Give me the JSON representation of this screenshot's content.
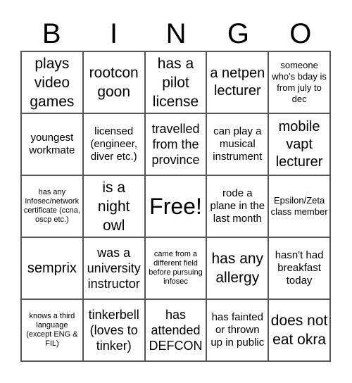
{
  "header": [
    "B",
    "I",
    "N",
    "G",
    "O"
  ],
  "cells": [
    "plays video games",
    "rootcon goon",
    "has a pilot license",
    "a netpen lecturer",
    "someone who's bday is from july to dec",
    "youngest workmate",
    "licensed (engineer, diver etc.)",
    "travelled from the province",
    "can play a musical instrument",
    "mobile vapt lecturer",
    "has any infosec/network certificate (ccna, oscp etc.)",
    "is a night owl",
    "Free!",
    "rode a plane in the last month",
    "Epsilon/Zeta class member",
    "semprix",
    "was a university instructor",
    "came from a different field before pursuing infosec",
    "has any allergy",
    "hasn't had breakfast today",
    "knows a third language (except ENG & FIL)",
    "tinkerbell (loves to tinker)",
    "has attended DEFCON",
    "has fainted or thrown up in public",
    "does not eat okra"
  ]
}
